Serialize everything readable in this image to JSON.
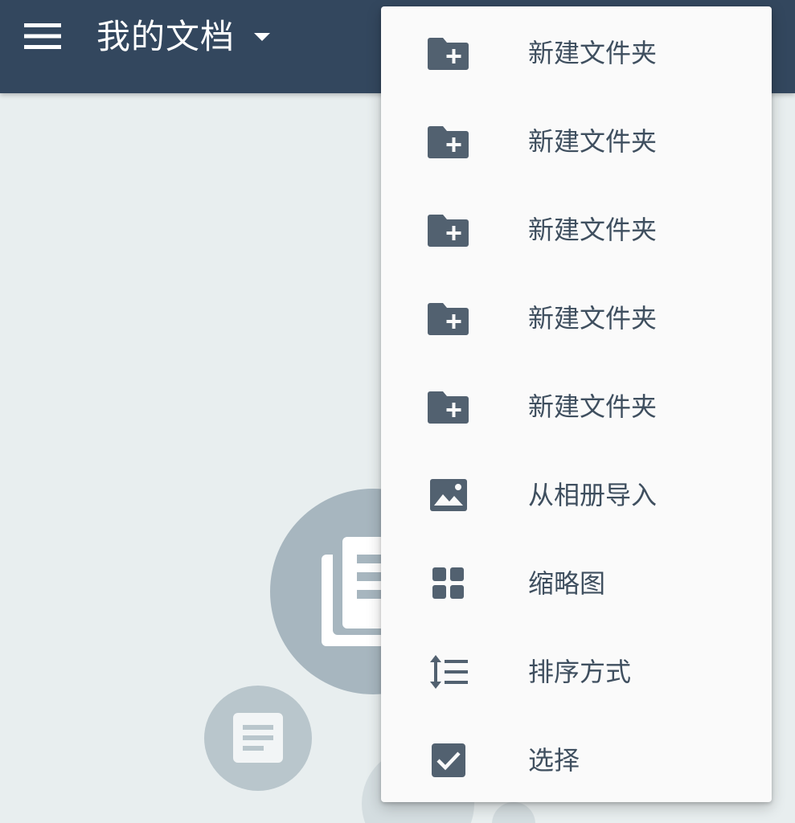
{
  "appbar": {
    "title": "我的文档",
    "menu_icon": "hamburger-menu-icon",
    "dropdown_icon": "caret-down-icon",
    "background_color": "#33475e"
  },
  "menu": {
    "items": [
      {
        "label": "新建文件夹",
        "icon": "create-folder-icon"
      },
      {
        "label": "新建文件夹",
        "icon": "create-folder-icon"
      },
      {
        "label": "新建文件夹",
        "icon": "create-folder-icon"
      },
      {
        "label": "新建文件夹",
        "icon": "create-folder-icon"
      },
      {
        "label": "新建文件夹",
        "icon": "create-folder-icon"
      },
      {
        "label": "从相册导入",
        "icon": "image-icon"
      },
      {
        "label": "缩略图",
        "icon": "grid-view-icon"
      },
      {
        "label": "排序方式",
        "icon": "sort-icon"
      },
      {
        "label": "选择",
        "icon": "checkbox-icon"
      }
    ],
    "icon_color": "#526170",
    "text_color": "#3f4f5f"
  },
  "empty_state": {
    "icons": [
      "document-library-icon",
      "document-icon"
    ]
  }
}
